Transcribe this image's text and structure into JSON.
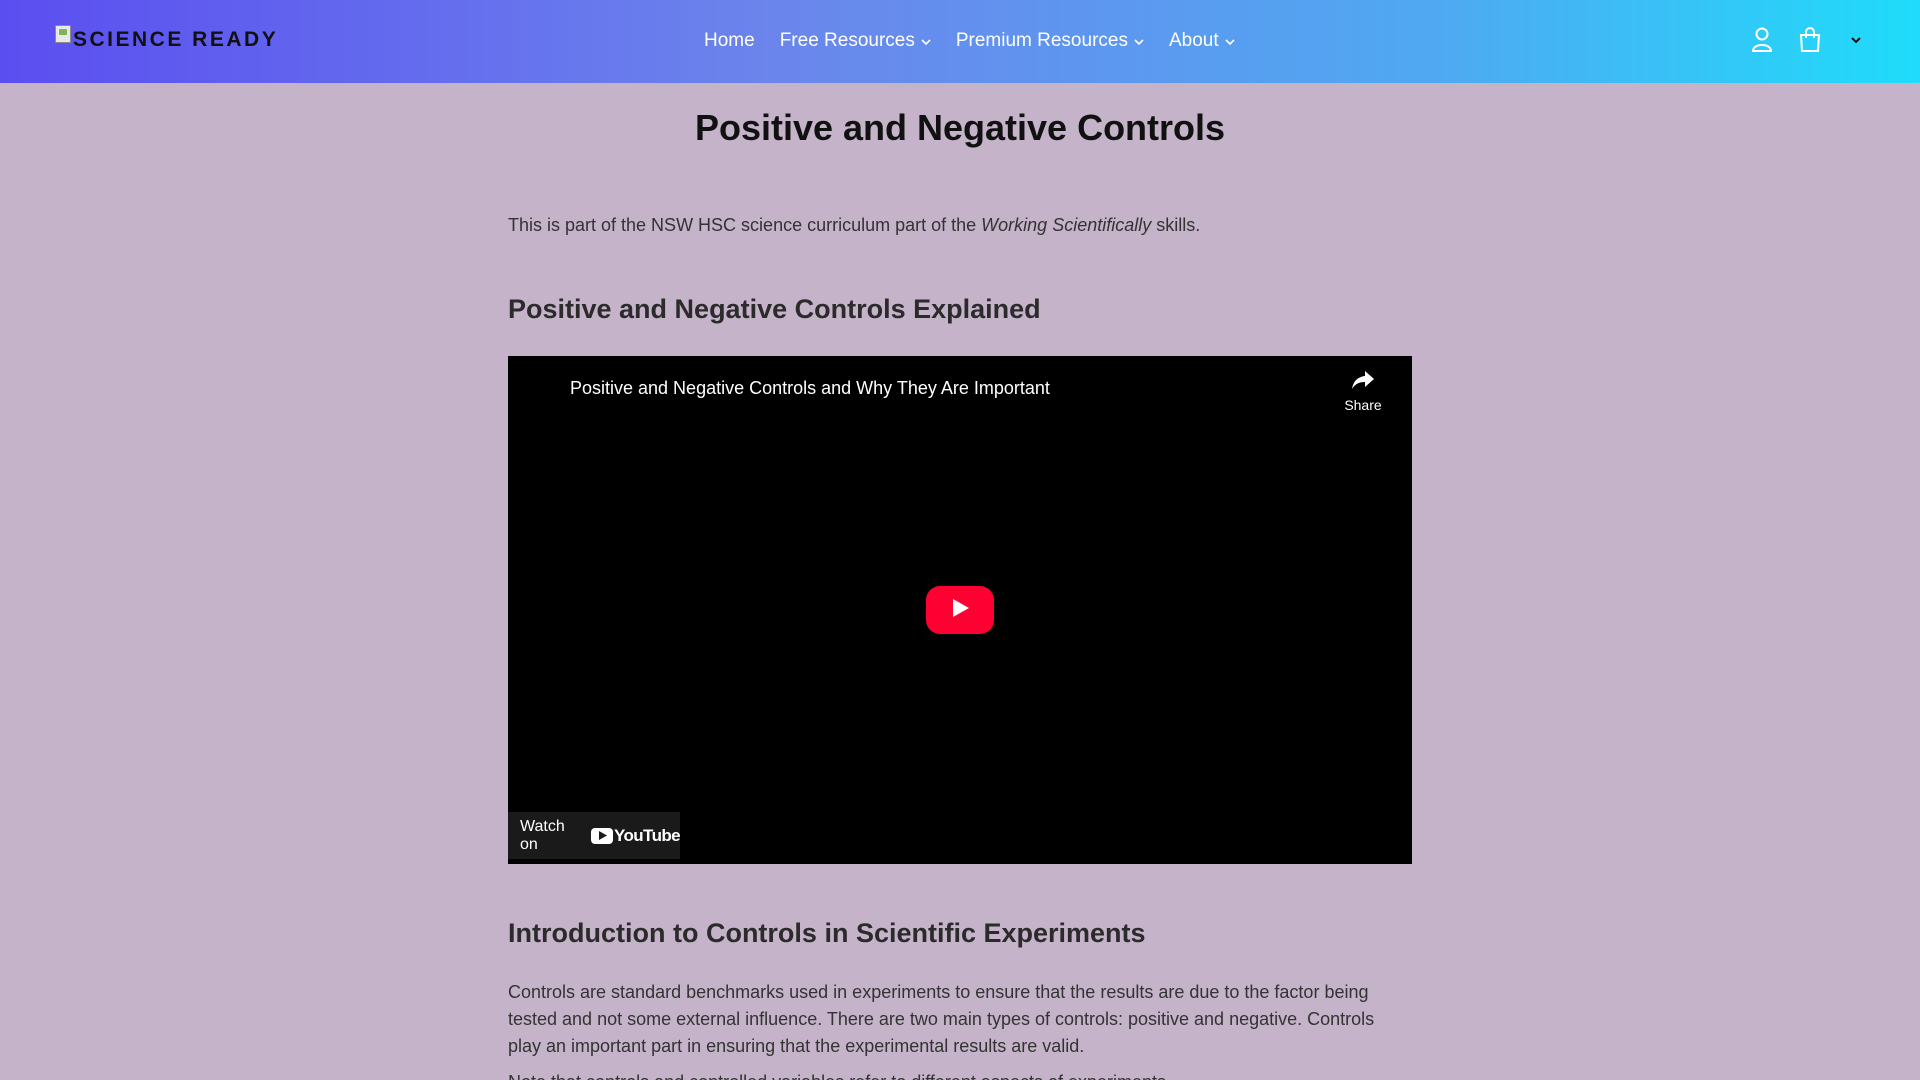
{
  "header": {
    "logo_text": "SCIENCE READY",
    "nav": [
      {
        "label": "Home",
        "has_dropdown": false
      },
      {
        "label": "Free Resources",
        "has_dropdown": true
      },
      {
        "label": "Premium Resources",
        "has_dropdown": true
      },
      {
        "label": "About",
        "has_dropdown": true
      }
    ],
    "icons": [
      "account-icon",
      "cart-icon",
      "chevron-down-icon"
    ],
    "colors": {
      "gradient_start": "#5b4ef0",
      "gradient_end": "#1fdcfb"
    }
  },
  "page": {
    "title": "Positive and Negative Controls",
    "intro_before": "This is part of the NSW HSC science curriculum part of the ",
    "intro_emphasis": "Working Scientifically",
    "intro_after": " skills.",
    "section1_heading": "Positive and Negative Controls Explained",
    "section2_heading": "Introduction to Controls in Scientific Experiments",
    "paragraph1": "Controls are standard benchmarks used in experiments to ensure that the results are due to the factor being tested and not some external influence. There are two main types of controls: positive and negative. Controls play an important part in ensuring that the experimental results are valid.",
    "paragraph2": "Note that controls and controlled variables refer to different aspects of experiments.",
    "background": "#c4b3c9"
  },
  "video": {
    "title": "Positive and Negative Controls and Why They Are Important",
    "share_label": "Share",
    "watch_on_label": "Watch on",
    "youtube_label": "YouTube",
    "play_color": "#ff0033"
  }
}
